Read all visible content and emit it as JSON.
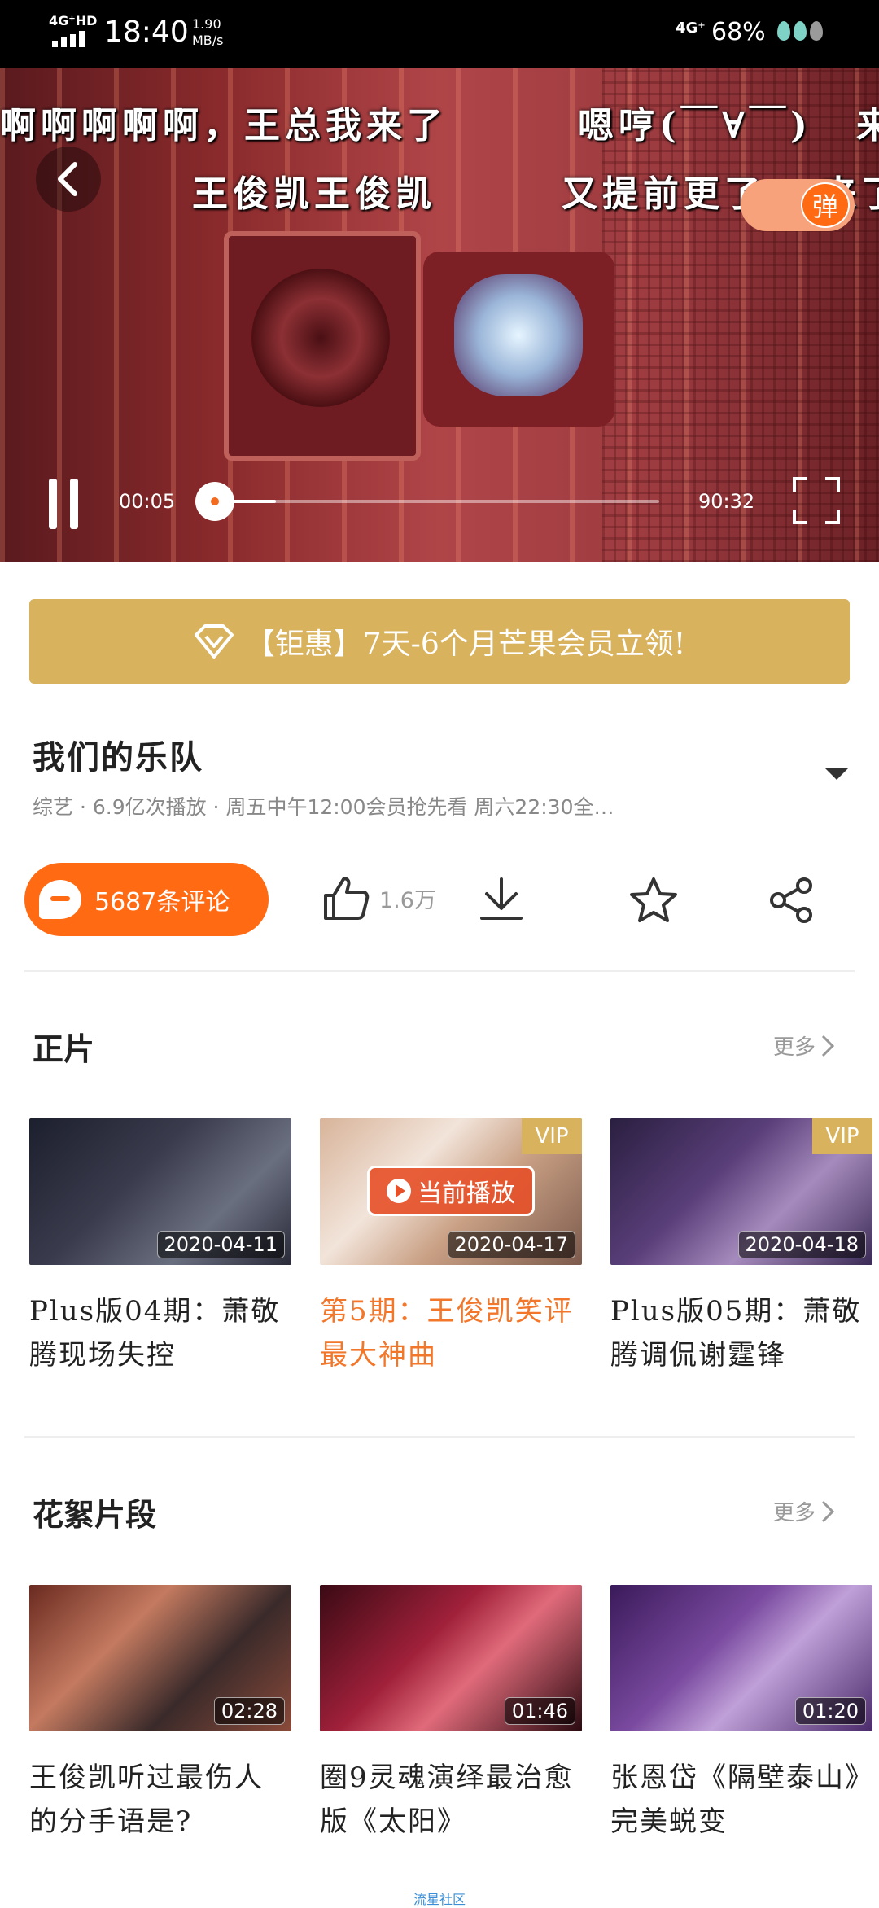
{
  "status_bar": {
    "network_left": "4G⁺HD",
    "time": "18:40",
    "speed_value": "1.90",
    "speed_unit": "MB/s",
    "network_right": "4G⁺",
    "battery": "68%"
  },
  "player": {
    "danmaku": [
      "啊啊啊啊啊，王总我来了",
      "嗯哼(￣∀￣)",
      "来",
      "王俊凯王俊凯",
      "又提前更了",
      "来了"
    ],
    "danmaku_toggle_label": "弹",
    "current_time": "00:05",
    "total_time": "90:32",
    "progress": 0.0009,
    "buffered": 0.14
  },
  "vip_banner": {
    "text": "【钜惠】7天-6个月芒果会员立领!"
  },
  "show": {
    "title": "我们的乐队",
    "meta": "综艺  ·  6.9亿次播放  ·  周五中午12:00会员抢先看 周六22:30全…"
  },
  "actions": {
    "comment_label": "5687条评论",
    "like_count": "1.6万"
  },
  "sections": [
    {
      "title": "正片",
      "more": "更多",
      "items": [
        {
          "badge": "2020-04-11",
          "vip": "",
          "playing": "",
          "title": "Plus版04期：萧敬腾现场失控"
        },
        {
          "badge": "2020-04-17",
          "vip": "VIP",
          "playing": "当前播放",
          "title": "第5期：王俊凯笑评最大神曲"
        },
        {
          "badge": "2020-04-18",
          "vip": "VIP",
          "playing": "",
          "title": "Plus版05期：萧敬腾调侃谢霆锋"
        }
      ]
    },
    {
      "title": "花絮片段",
      "more": "更多",
      "items": [
        {
          "badge": "02:28",
          "vip": "",
          "playing": "",
          "title": "王俊凯听过最伤人的分手语是?"
        },
        {
          "badge": "01:46",
          "vip": "",
          "playing": "",
          "title": "圈9灵魂演绎最治愈版《太阳》"
        },
        {
          "badge": "01:20",
          "vip": "",
          "playing": "",
          "title": "张恩岱《隔壁泰山》完美蜕变"
        }
      ]
    }
  ],
  "footer": {
    "text": "流星社区"
  },
  "colors": {
    "accent": "#ff6a13",
    "vip_gold": "#d8b25d",
    "current_title": "#f2772a"
  }
}
